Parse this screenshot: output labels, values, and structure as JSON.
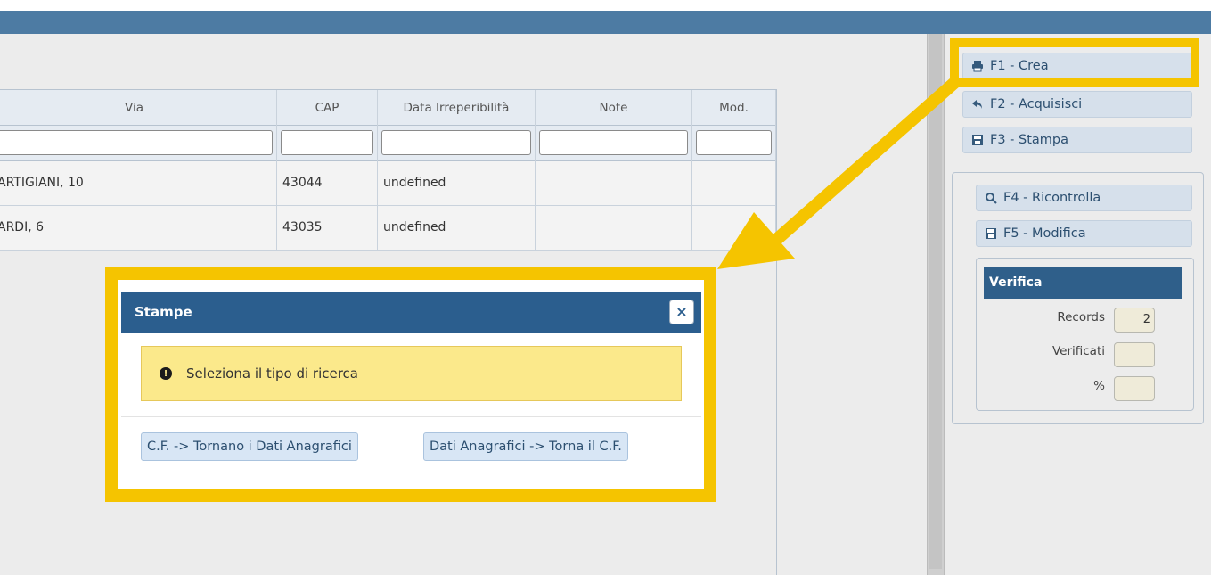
{
  "table": {
    "columns": [
      "Via",
      "CAP",
      "Data Irreperibilità",
      "Note",
      "Mod."
    ],
    "rows": [
      {
        "via": "ARTIGIANI, 10",
        "cap": "43044",
        "data": "undefined",
        "note": "",
        "mod": ""
      },
      {
        "via": "ARDI, 6",
        "cap": "43035",
        "data": "undefined",
        "note": "",
        "mod": ""
      }
    ]
  },
  "sidebar": {
    "buttons": [
      {
        "label": "F1 - Crea",
        "icon": "printer-icon"
      },
      {
        "label": "F2 - Acquisisci",
        "icon": "reply-icon"
      },
      {
        "label": "F3 - Stampa",
        "icon": "save-icon"
      },
      {
        "label": "F4 - Ricontrolla",
        "icon": "search-icon"
      },
      {
        "label": "F5 - Modifica",
        "icon": "save-icon"
      }
    ],
    "verifica": {
      "title": "Verifica",
      "records_label": "Records",
      "records_value": "2",
      "verificati_label": "Verificati",
      "verificati_value": "",
      "percent_label": "%",
      "percent_value": ""
    }
  },
  "dialog": {
    "title": "Stampe",
    "close": "×",
    "message": "Seleziona il tipo di ricerca",
    "buttons": [
      "C.F. -> Tornano i Dati Anagrafici",
      "Dati Anagrafici -> Torna il C.F."
    ]
  },
  "colors": {
    "accent": "#2b5e8e",
    "highlight": "#f5c400",
    "alert": "#fbe98b"
  }
}
